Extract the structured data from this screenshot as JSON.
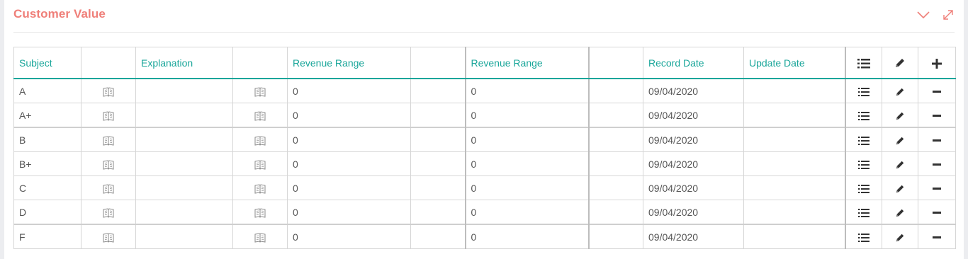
{
  "panel": {
    "title": "Customer Value",
    "collapse_icon": "chevron-down-icon",
    "expand_icon": "expand-icon",
    "title_color": "#ef7f79"
  },
  "table": {
    "accent_color": "#1aa69a",
    "headers": {
      "subject": "Subject",
      "explanation": "Explanation",
      "revenue_from": "Revenue Range",
      "revenue_to": "Revenue Range",
      "record_date": "Record Date",
      "update_date": "Update Date",
      "list_icon": "list-icon",
      "edit_icon": "pencil-icon",
      "add_icon": "plus-icon"
    },
    "rows": [
      {
        "subject": "A",
        "explanation": "",
        "revenue_from": "0",
        "revenue_to": "0",
        "record_date": "09/04/2020",
        "update_date": ""
      },
      {
        "subject": "A+",
        "explanation": "",
        "revenue_from": "0",
        "revenue_to": "0",
        "record_date": "09/04/2020",
        "update_date": ""
      },
      {
        "subject": "B",
        "explanation": "",
        "revenue_from": "0",
        "revenue_to": "0",
        "record_date": "09/04/2020",
        "update_date": ""
      },
      {
        "subject": "B+",
        "explanation": "",
        "revenue_from": "0",
        "revenue_to": "0",
        "record_date": "09/04/2020",
        "update_date": ""
      },
      {
        "subject": "C",
        "explanation": "",
        "revenue_from": "0",
        "revenue_to": "0",
        "record_date": "09/04/2020",
        "update_date": ""
      },
      {
        "subject": "D",
        "explanation": "",
        "revenue_from": "0",
        "revenue_to": "0",
        "record_date": "09/04/2020",
        "update_date": ""
      },
      {
        "subject": "F",
        "explanation": "",
        "revenue_from": "0",
        "revenue_to": "0",
        "record_date": "09/04/2020",
        "update_date": ""
      }
    ],
    "row_icons": {
      "translate": "book-icon",
      "details": "list-icon",
      "edit": "pencil-icon",
      "delete": "minus-icon"
    }
  }
}
